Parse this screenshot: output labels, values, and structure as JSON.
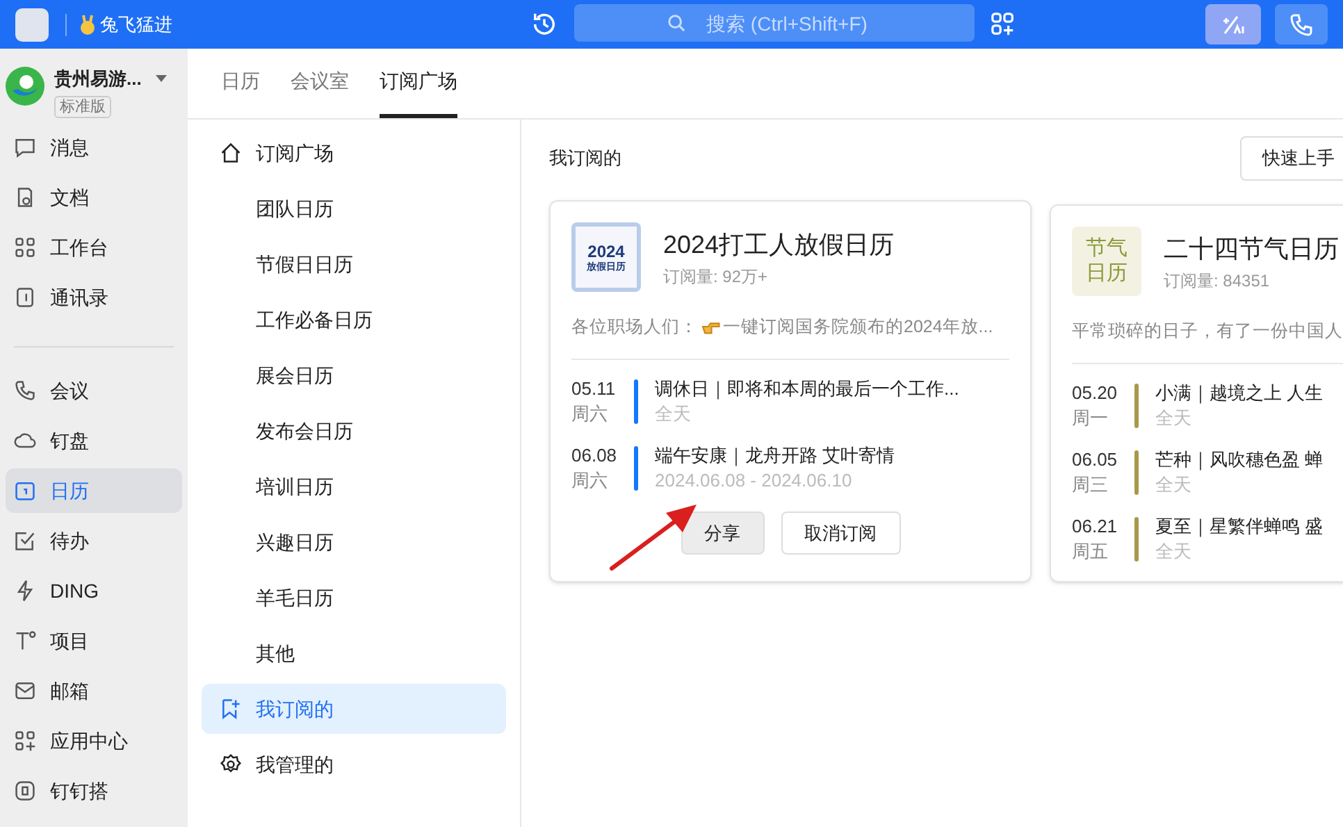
{
  "top_bar": {
    "status": "兔飞猛进",
    "search": {
      "placeholder": "搜索 (Ctrl+Shift+F)"
    }
  },
  "org": {
    "name": "贵州易游...",
    "badge": "标准版"
  },
  "nav_groups": [
    [
      {
        "label": "消息",
        "selected": false
      },
      {
        "label": "文档",
        "selected": false
      },
      {
        "label": "工作台",
        "selected": false
      },
      {
        "label": "通讯录",
        "selected": false
      }
    ],
    [
      {
        "label": "会议",
        "selected": false
      },
      {
        "label": "钉盘",
        "selected": false
      },
      {
        "label": "日历",
        "selected": true
      },
      {
        "label": "待办",
        "selected": false
      },
      {
        "label": "DING",
        "selected": false
      },
      {
        "label": "项目",
        "selected": false
      },
      {
        "label": "邮箱",
        "selected": false
      },
      {
        "label": "应用中心",
        "selected": false
      },
      {
        "label": "钉钉搭",
        "selected": false
      }
    ]
  ],
  "tabs": [
    {
      "label": "日历",
      "selected": false
    },
    {
      "label": "会议室",
      "selected": false
    },
    {
      "label": "订阅广场",
      "selected": true
    }
  ],
  "menu": [
    {
      "label": "订阅广场",
      "selected": false
    },
    {
      "label": "团队日历",
      "selected": false
    },
    {
      "label": "节假日日历",
      "selected": false
    },
    {
      "label": "工作必备日历",
      "selected": false
    },
    {
      "label": "展会日历",
      "selected": false
    },
    {
      "label": "发布会日历",
      "selected": false
    },
    {
      "label": "培训日历",
      "selected": false
    },
    {
      "label": "兴趣日历",
      "selected": false
    },
    {
      "label": "羊毛日历",
      "selected": false
    },
    {
      "label": "其他",
      "selected": false
    },
    {
      "label": "我订阅的",
      "selected": true
    },
    {
      "label": "我管理的",
      "selected": false
    }
  ],
  "section_title": "我订阅的",
  "quick_start": "快速上手",
  "cards": [
    {
      "logo": {
        "kind": "year",
        "line1": "2024",
        "line2": "放假日历"
      },
      "title": "2024打工人放假日历",
      "subscribers": "订阅量: 92万+",
      "description_prefix": "各位职场人们：",
      "description": "一键订阅国务院颁布的2024年放...",
      "color": "#1677ff",
      "events": [
        {
          "date": "05.11",
          "weekday": "周六",
          "title": "调休日｜即将和本周的最后一个工作...",
          "time": "全天"
        },
        {
          "date": "06.08",
          "weekday": "周六",
          "title": "端午安康｜龙舟开路 艾叶寄情",
          "time": "2024.06.08 - 2024.06.10"
        }
      ],
      "buttons": [
        {
          "label": "分享",
          "hovered": true
        },
        {
          "label": "取消订阅",
          "hovered": false
        }
      ]
    },
    {
      "logo": {
        "kind": "text",
        "line1": "节气",
        "line2": "日历"
      },
      "title": "二十四节气日历",
      "subscribers": "订阅量: 84351",
      "description": "平常琐碎的日子，有了一份中国人",
      "color": "#a8994a",
      "events": [
        {
          "date": "05.20",
          "weekday": "周一",
          "title": "小满｜越境之上 人生",
          "time": "全天"
        },
        {
          "date": "06.05",
          "weekday": "周三",
          "title": "芒种｜风吹穗色盈 蝉",
          "time": "全天"
        },
        {
          "date": "06.21",
          "weekday": "周五",
          "title": "夏至｜星繁伴蝉鸣 盛",
          "time": "全天"
        }
      ]
    }
  ]
}
